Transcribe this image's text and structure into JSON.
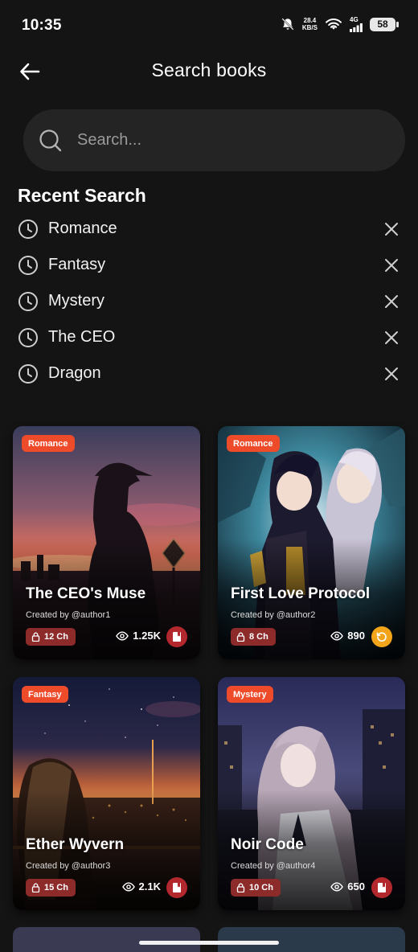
{
  "status_bar": {
    "time": "10:35",
    "speed_value": "28.4",
    "speed_unit": "KB/S",
    "network": "4G",
    "battery": "58"
  },
  "header": {
    "title": "Search books",
    "back_icon": "arrow-left-icon"
  },
  "search": {
    "placeholder": "Search...",
    "value": ""
  },
  "recent": {
    "title": "Recent Search",
    "items": [
      {
        "label": "Romance"
      },
      {
        "label": "Fantasy"
      },
      {
        "label": "Mystery"
      },
      {
        "label": "The CEO"
      },
      {
        "label": "Dragon"
      }
    ]
  },
  "books": [
    {
      "genre": "Romance",
      "title": "The CEO's Muse",
      "author": "Created by @author1",
      "chapters": "12 Ch",
      "views": "1.25K",
      "action_icon": "book-icon"
    },
    {
      "genre": "Romance",
      "title": "First Love Protocol",
      "author": "Created by @author2",
      "chapters": "8 Ch",
      "views": "890",
      "action_icon": "history-icon"
    },
    {
      "genre": "Fantasy",
      "title": "Ether Wyvern",
      "author": "Created by @author3",
      "chapters": "15 Ch",
      "views": "2.1K",
      "action_icon": "book-icon"
    },
    {
      "genre": "Mystery",
      "title": "Noir Code",
      "author": "Created by @author4",
      "chapters": "10 Ch",
      "views": "650",
      "action_icon": "book-icon"
    }
  ],
  "colors": {
    "background": "#141414",
    "search_bg": "#242424",
    "badge": "#ee4b2b",
    "chapter_pill": "#8d2a2a",
    "action_red": "#b3282c",
    "action_orange": "#f2a51a"
  }
}
